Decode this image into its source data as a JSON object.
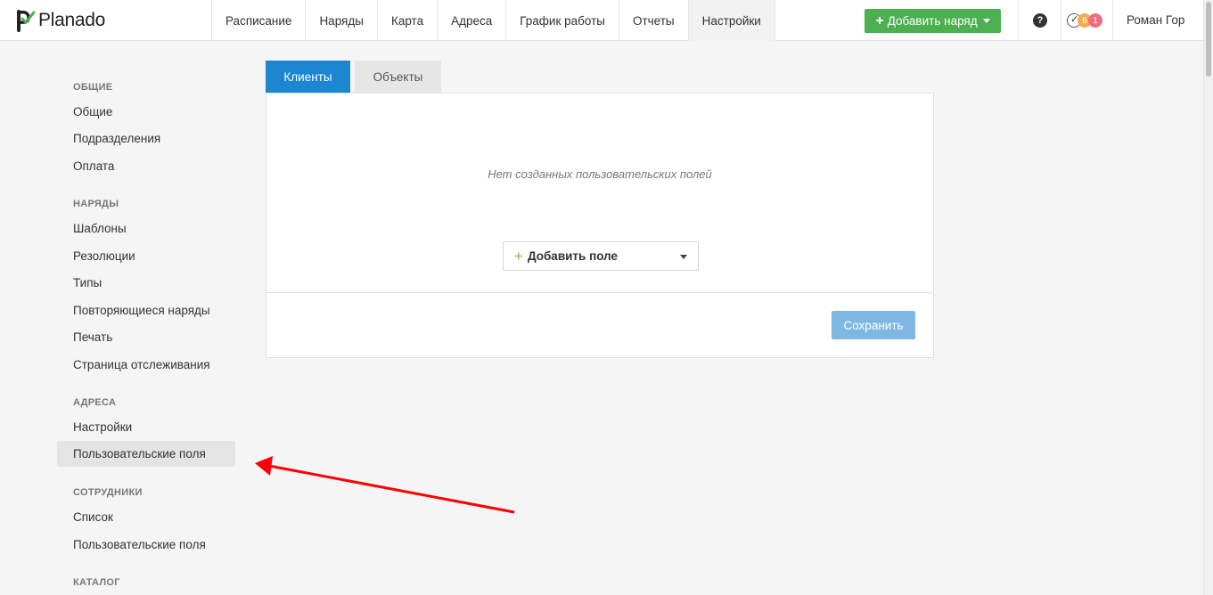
{
  "app": {
    "logo_text": "Planado"
  },
  "nav": [
    {
      "label": "Расписание",
      "active": false
    },
    {
      "label": "Наряды",
      "active": false
    },
    {
      "label": "Карта",
      "active": false
    },
    {
      "label": "Адреса",
      "active": false
    },
    {
      "label": "График работы",
      "active": false
    },
    {
      "label": "Отчеты",
      "active": false
    },
    {
      "label": "Настройки",
      "active": true
    }
  ],
  "header": {
    "add_order_label": "Добавить наряд",
    "help_glyph": "?",
    "tasks_badge_orange": "6",
    "tasks_badge_red": "1",
    "user_name": "Роман Гор"
  },
  "sidebar": {
    "general": {
      "heading": "ОБЩИЕ",
      "items": [
        "Общие",
        "Подразделения",
        "Оплата"
      ]
    },
    "orders": {
      "heading": "НАРЯДЫ",
      "items": [
        "Шаблоны",
        "Резолюции",
        "Типы",
        "Повторяющиеся наряды",
        "Печать",
        "Страница отслеживания"
      ]
    },
    "addresses": {
      "heading": "АДРЕСА",
      "items": [
        "Настройки",
        "Пользовательские поля"
      ]
    },
    "employees": {
      "heading": "СОТРУДНИКИ",
      "items": [
        "Список",
        "Пользовательские поля"
      ]
    },
    "catalog": {
      "heading": "КАТАЛОГ"
    }
  },
  "main": {
    "tabs": [
      {
        "label": "Клиенты",
        "active": true
      },
      {
        "label": "Объекты",
        "active": false
      }
    ],
    "empty_message": "Нет созданных пользовательских полей",
    "add_field_label": "Добавить поле",
    "save_label": "Сохранить"
  },
  "colors": {
    "primary": "#1c86d1",
    "success": "#4caf50",
    "save_disabled": "#7fb7e3",
    "annotation_arrow": "#ff0000"
  }
}
